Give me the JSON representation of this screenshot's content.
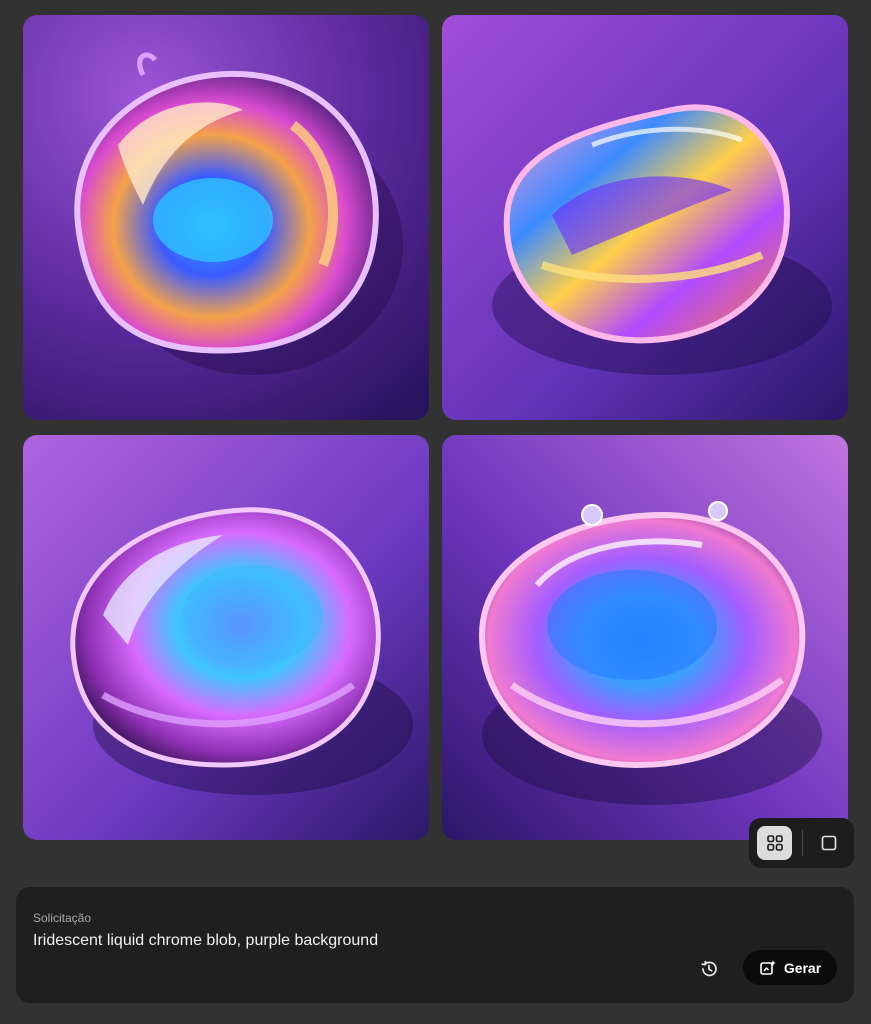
{
  "gallery": {
    "images": [
      {
        "id": "result-1"
      },
      {
        "id": "result-2"
      },
      {
        "id": "result-3"
      },
      {
        "id": "result-4"
      }
    ]
  },
  "view_toggle": {
    "grid_icon": "grid-four-icon",
    "single_icon": "square-icon",
    "active": "grid"
  },
  "prompt": {
    "label": "Solicitação",
    "text": "Iridescent liquid chrome blob, purple background"
  },
  "actions": {
    "history_icon": "history-icon",
    "generate_label": "Gerar",
    "generate_icon": "generate-sparkle-icon"
  },
  "colors": {
    "page_bg": "#323232",
    "panel_bg": "#1f1f1f",
    "button_bg": "#0b0b0b",
    "accent_purple": "#7b3fc4"
  }
}
